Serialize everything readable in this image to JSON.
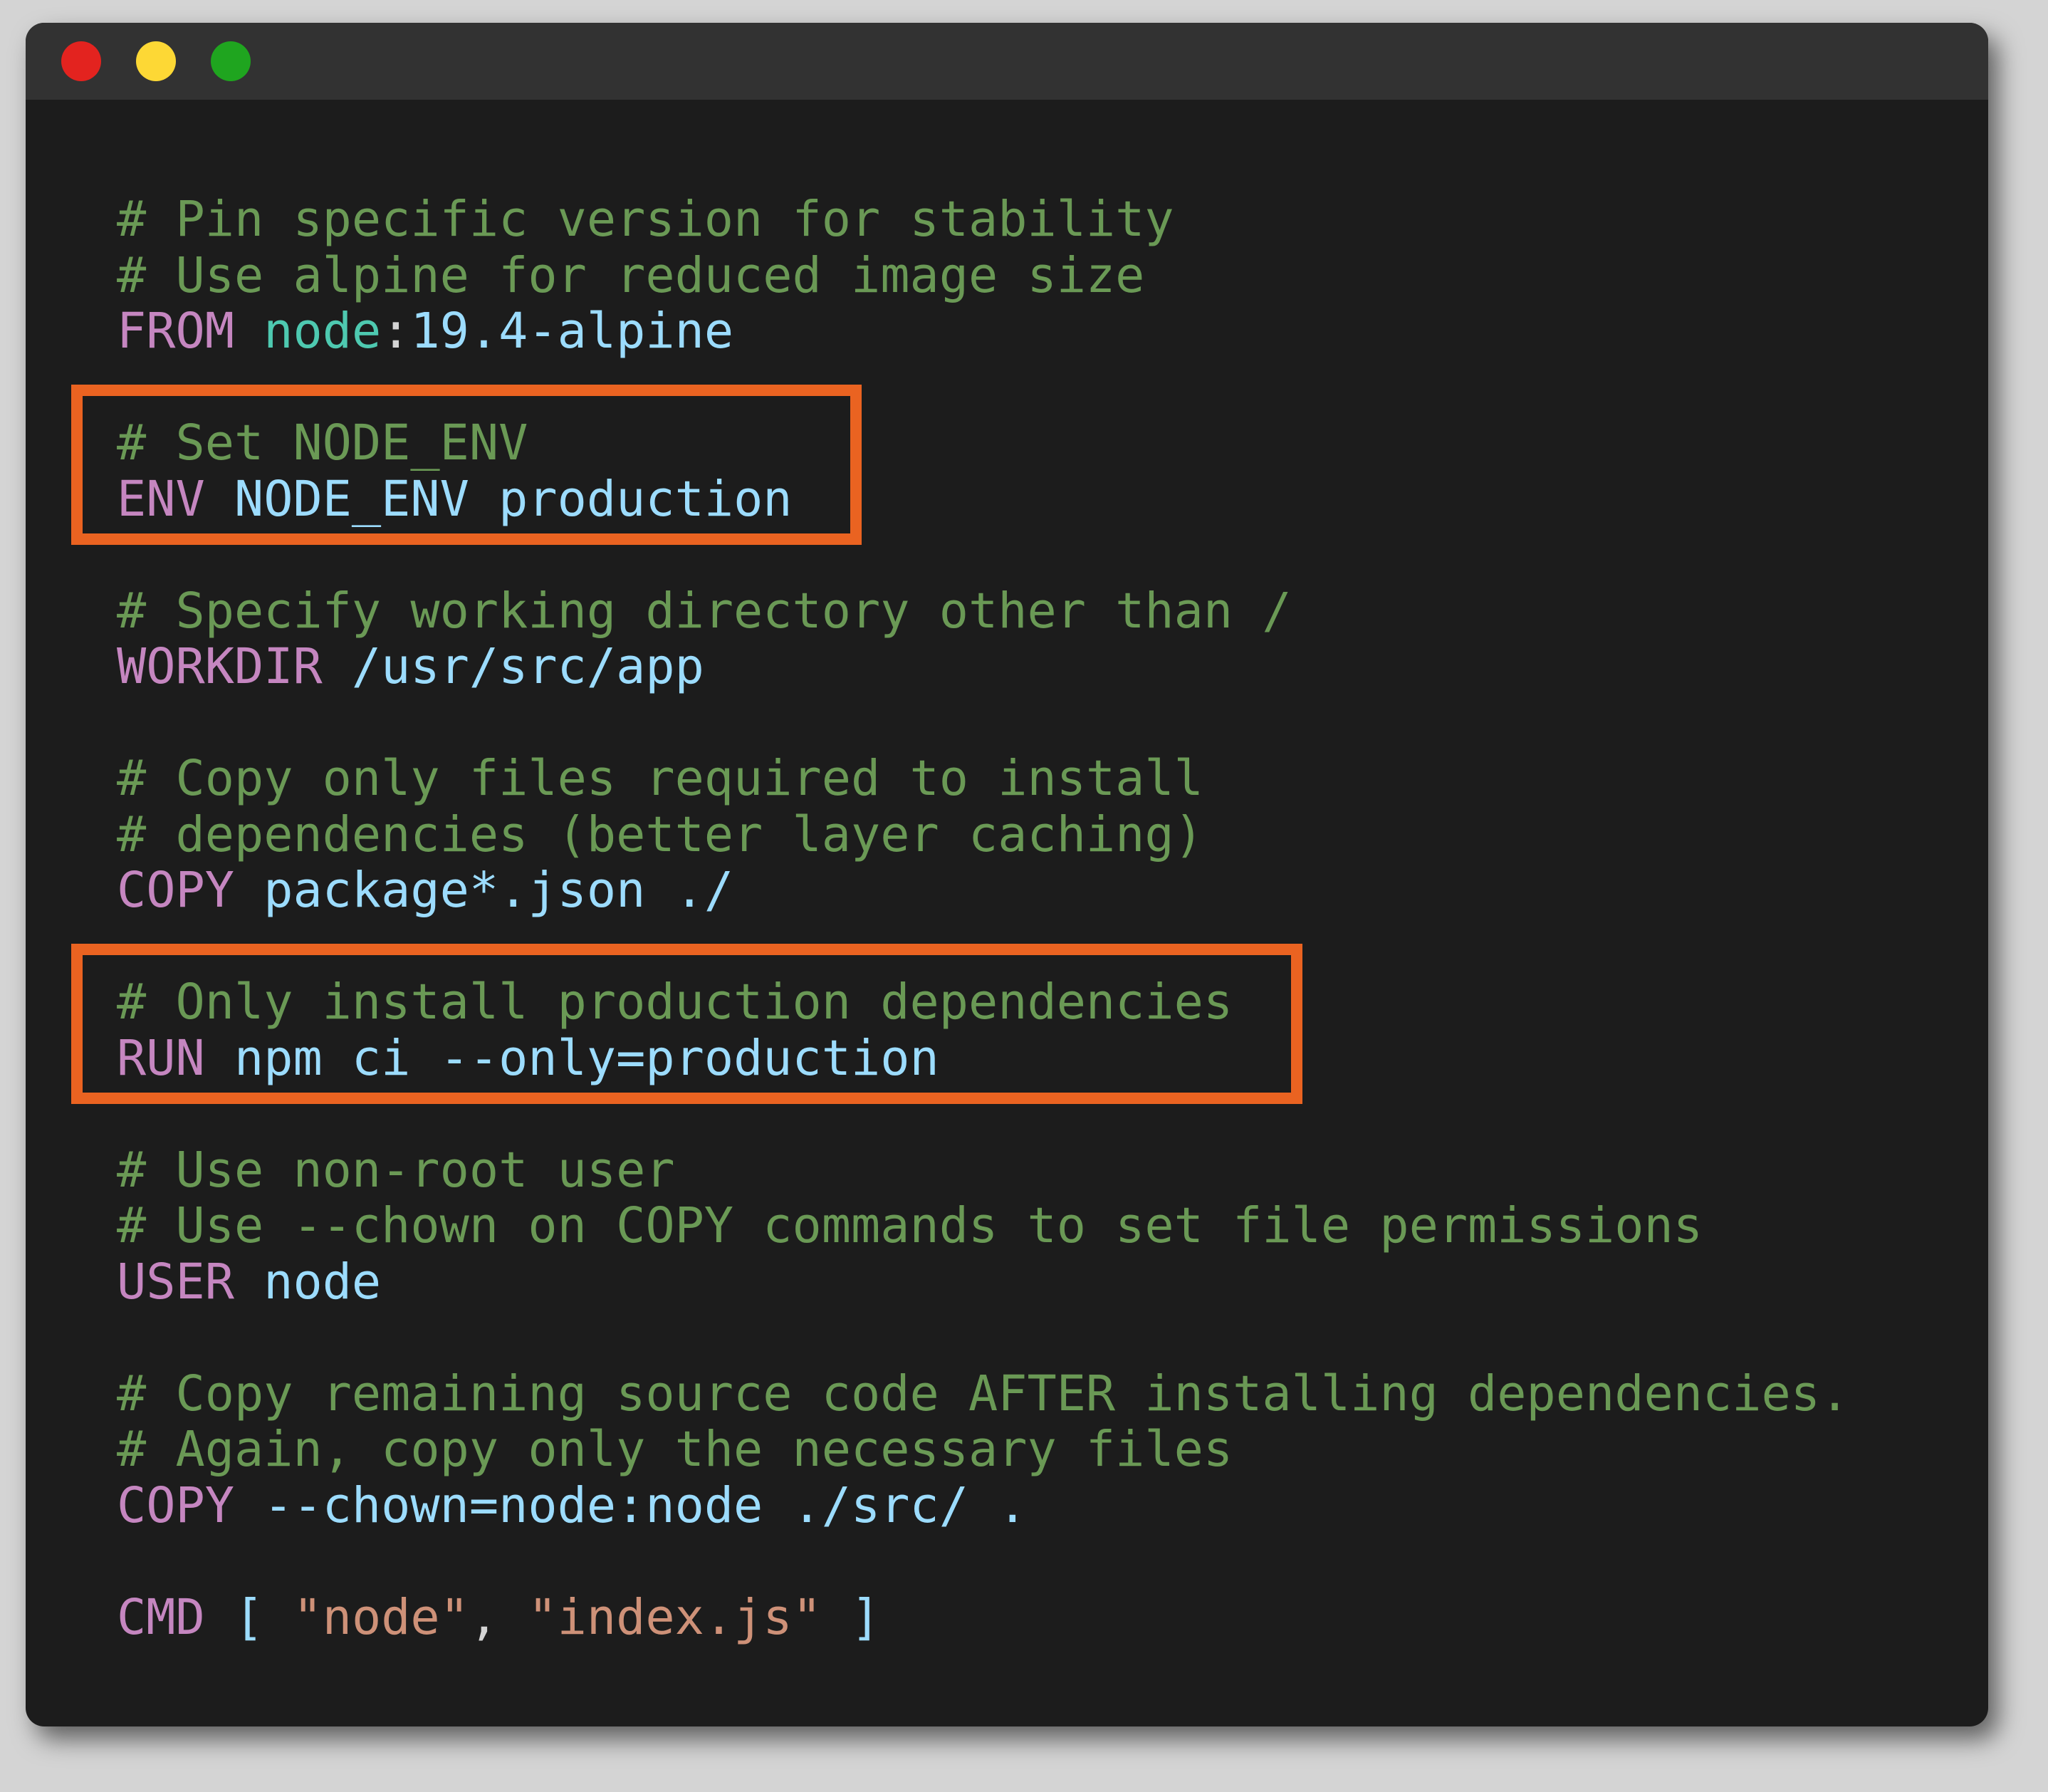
{
  "window": {
    "controls": [
      "close",
      "minimize",
      "maximize"
    ]
  },
  "colors": {
    "page_bg": "#d4d4d4",
    "window_bg": "#1c1c1c",
    "titlebar_bg": "#323232",
    "close": "#e3231f",
    "minimize": "#fdd835",
    "maximize": "#1fa51f",
    "comment": "#6a9955",
    "keyword": "#c586c0",
    "value": "#9cdcfe",
    "type": "#4ec9b0",
    "string": "#ce9178",
    "plain": "#d4d4d4",
    "highlight": "#ea6321"
  },
  "code": {
    "lines": [
      [
        {
          "t": "# Pin specific version for stability",
          "c": "comment"
        }
      ],
      [
        {
          "t": "# Use alpine for reduced image size",
          "c": "comment"
        }
      ],
      [
        {
          "t": "FROM",
          "c": "keyword"
        },
        {
          "t": " ",
          "c": "plain"
        },
        {
          "t": "node",
          "c": "type"
        },
        {
          "t": ":",
          "c": "plain"
        },
        {
          "t": "19.4-alpine",
          "c": "value"
        }
      ],
      [],
      [
        {
          "t": "# Set NODE_ENV",
          "c": "comment"
        }
      ],
      [
        {
          "t": "ENV",
          "c": "keyword"
        },
        {
          "t": " NODE_ENV production",
          "c": "value"
        }
      ],
      [],
      [
        {
          "t": "# Specify working directory other than /",
          "c": "comment"
        }
      ],
      [
        {
          "t": "WORKDIR",
          "c": "keyword"
        },
        {
          "t": " /usr/src/app",
          "c": "value"
        }
      ],
      [],
      [
        {
          "t": "# Copy only files required to install",
          "c": "comment"
        }
      ],
      [
        {
          "t": "# dependencies (better layer caching)",
          "c": "comment"
        }
      ],
      [
        {
          "t": "COPY",
          "c": "keyword"
        },
        {
          "t": " package*.json ./",
          "c": "value"
        }
      ],
      [],
      [
        {
          "t": "# Only install production dependencies",
          "c": "comment"
        }
      ],
      [
        {
          "t": "RUN",
          "c": "keyword"
        },
        {
          "t": " npm ci --only=production",
          "c": "value"
        }
      ],
      [],
      [
        {
          "t": "# Use non-root user",
          "c": "comment"
        }
      ],
      [
        {
          "t": "# Use --chown on COPY commands to set file permissions",
          "c": "comment"
        }
      ],
      [
        {
          "t": "USER",
          "c": "keyword"
        },
        {
          "t": " node",
          "c": "value"
        }
      ],
      [],
      [
        {
          "t": "# Copy remaining source code AFTER installing dependencies.",
          "c": "comment"
        }
      ],
      [
        {
          "t": "# Again, copy only the necessary files",
          "c": "comment"
        }
      ],
      [
        {
          "t": "COPY",
          "c": "keyword"
        },
        {
          "t": " --chown=node:node ./src/ .",
          "c": "value"
        }
      ],
      [],
      [
        {
          "t": "CMD",
          "c": "keyword"
        },
        {
          "t": " [ ",
          "c": "value"
        },
        {
          "t": "\"node\"",
          "c": "string"
        },
        {
          "t": ", ",
          "c": "plain"
        },
        {
          "t": "\"index.js\"",
          "c": "string"
        },
        {
          "t": " ]",
          "c": "value"
        }
      ]
    ],
    "highlights": [
      {
        "name": "highlight-set-node-env",
        "from_line": 4,
        "to_line": 5
      },
      {
        "name": "highlight-npm-ci",
        "from_line": 14,
        "to_line": 15
      }
    ]
  }
}
